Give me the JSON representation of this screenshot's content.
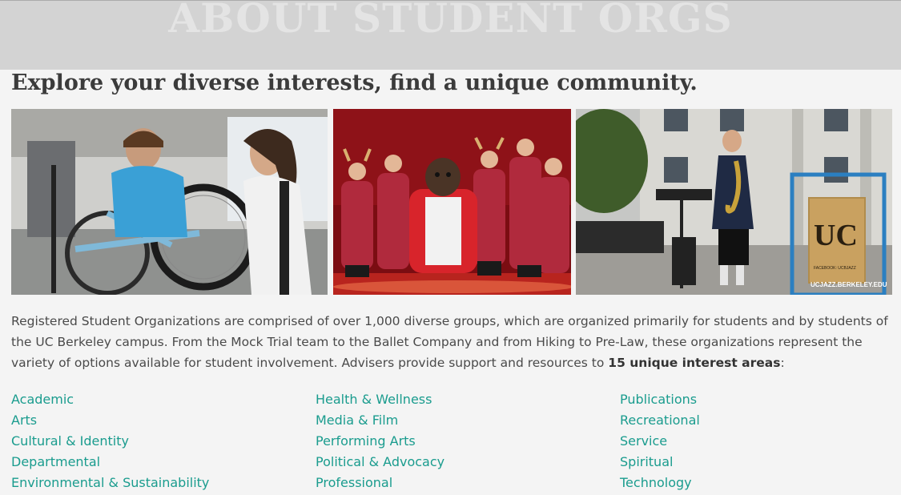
{
  "banner": {
    "title": "ABOUT STUDENT ORGS"
  },
  "headline": "Explore your diverse interests, find a unique community.",
  "intro": {
    "text": "Registered Student Organizations are comprised of over 1,000 diverse groups, which are organized primarily for students and by students of the UC Berkeley campus. From the Mock Trial team to the Ballet Company and from Hiking to Pre-Law, these organizations represent the variety of options available for student involvement. Advisers provide support and resources to ",
    "bold": "15 unique interest areas",
    "end": ":"
  },
  "photos": {
    "jazz_sign_lines": [
      "UC",
      "FACEBOOK: UCBJAZZ",
      "UCJAZZ.BERKELEY.EDU"
    ]
  },
  "interest_areas": {
    "col1": [
      "Academic",
      "Arts",
      "Cultural & Identity",
      "Departmental",
      "Environmental & Sustainability"
    ],
    "col2": [
      "Health & Wellness",
      "Media & Film",
      "Performing Arts",
      "Political & Advocacy",
      "Professional"
    ],
    "col3": [
      "Publications",
      "Recreational",
      "Service",
      "Spiritual",
      "Technology"
    ]
  },
  "colors": {
    "link": "#1a9c8e",
    "banner": "#d3d3d3",
    "background": "#f4f4f4"
  }
}
